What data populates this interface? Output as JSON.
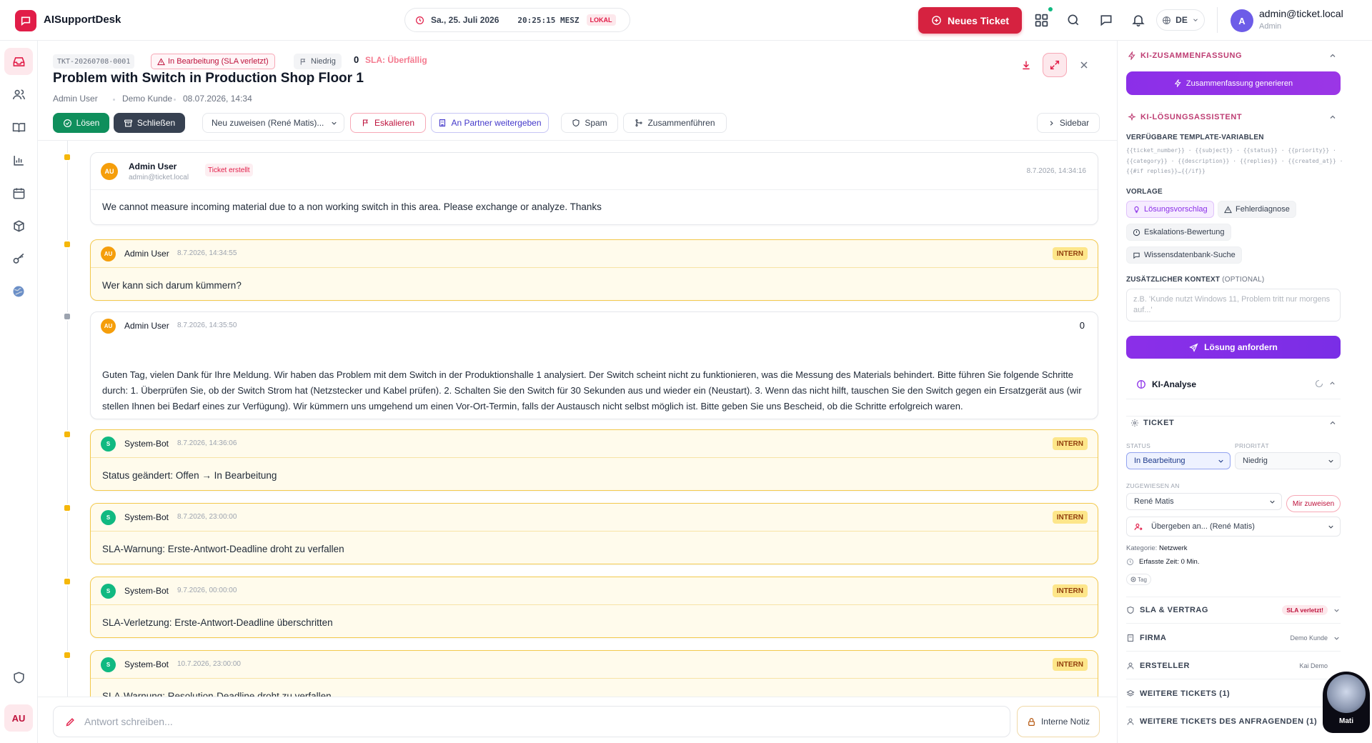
{
  "app": {
    "name": "AISupportDesk"
  },
  "datetime": {
    "date": "Sa., 25. Juli 2026",
    "time": "20:25:15 MESZ",
    "badge": "LOKAL"
  },
  "header": {
    "new_ticket": "Neues Ticket",
    "lang": "DE",
    "user_email": "admin@ticket.local",
    "user_role": "Admin",
    "avatar": "A"
  },
  "rail": {
    "avatar": "AU",
    "items": [
      "inbox-icon",
      "users-icon",
      "book-icon",
      "chart-icon",
      "calendar-icon",
      "box-icon",
      "key-icon",
      "globe-icon",
      "shield-icon"
    ]
  },
  "ticket": {
    "id": "TKT-20260708-0001",
    "status": "In Bearbeitung (SLA verletzt)",
    "priority": "Niedrig",
    "count": "0",
    "sla": "SLA: Überfällig",
    "title": "Problem with Switch in Production Shop Floor 1",
    "meta": [
      "Admin User",
      "Demo Kunde",
      "08.07.2026, 14:34"
    ],
    "actions": {
      "resolve": "Lösen",
      "close": "Schließen",
      "reassign": "Neu zuweisen (René Matis)...",
      "escalate": "Eskalieren",
      "partner": "An Partner weitergeben",
      "spam": "Spam",
      "merge": "Zusammenführen",
      "sidebar": "Sidebar"
    }
  },
  "timeline": [
    {
      "author": "Admin User",
      "email": "admin@ticket.local",
      "tag": "Ticket erstellt",
      "time": "8.7.2026, 14:34:16",
      "body": "We cannot measure incoming material due to a non working switch in this area. Please exchange or analyze. Thanks",
      "avatar": "AU"
    },
    {
      "author": "Admin User",
      "time": "8.7.2026, 14:34:55",
      "badge": "INTERN",
      "body": "Wer kann sich darum kümmern?",
      "avatar": "AU"
    },
    {
      "author": "Admin User",
      "time": "8.7.2026, 14:35:50",
      "count": "0",
      "body": "Guten Tag, vielen Dank für Ihre Meldung. Wir haben das Problem mit dem Switch in der Produktionshalle 1 analysiert. Der Switch scheint nicht zu funktionieren, was die Messung des Materials behindert. Bitte führen Sie folgende Schritte durch: 1. Überprüfen Sie, ob der Switch Strom hat (Netzstecker und Kabel prüfen). 2. Schalten Sie den Switch für 30 Sekunden aus und wieder ein (Neustart). 3. Wenn das nicht hilft, tauschen Sie den Switch gegen ein Ersatzgerät aus (wir stellen Ihnen bei Bedarf eines zur Verfügung). Wir kümmern uns umgehend um einen Vor-Ort-Termin, falls der Austausch nicht selbst möglich ist. Bitte geben Sie uns Bescheid, ob die Schritte erfolgreich waren.",
      "avatar": "AU"
    },
    {
      "author": "System-Bot",
      "time": "8.7.2026, 14:36:06",
      "badge": "INTERN",
      "body": "Status geändert: Offen → In Bearbeitung",
      "avatar": "S"
    },
    {
      "author": "System-Bot",
      "time": "8.7.2026, 23:00:00",
      "badge": "INTERN",
      "body": "SLA-Warnung: Erste-Antwort-Deadline droht zu verfallen",
      "avatar": "S"
    },
    {
      "author": "System-Bot",
      "time": "9.7.2026, 00:00:00",
      "badge": "INTERN",
      "body": "SLA-Verletzung: Erste-Antwort-Deadline überschritten",
      "avatar": "S"
    },
    {
      "author": "System-Bot",
      "time": "10.7.2026, 23:00:00",
      "badge": "INTERN",
      "body": "SLA-Warnung: Resolution-Deadline droht zu verfallen",
      "avatar": "S"
    }
  ],
  "reply": {
    "placeholder": "Antwort schreiben...",
    "note": "Interne Notiz"
  },
  "sidebar": {
    "summary_title": "KI-ZUSAMMENFASSUNG",
    "summary_btn": "Zusammenfassung generieren",
    "assistant_title": "KI-LÖSUNGSASSISTENT",
    "vars_label": "VERFÜGBARE TEMPLATE-VARIABLEN",
    "vars": "{{ticket_number}} · {{subject}} · {{status}} · {{priority}} · {{category}} · {{description}} · {{replies}} · {{created_at}} · {{#if replies}}…{{/if}}",
    "template_label": "VORLAGE",
    "templates": [
      "Lösungsvorschlag",
      "Fehlerdiagnose",
      "Eskalations-Bewertung",
      "Wissensdatenbank-Suche"
    ],
    "context_label": "ZUSÄTZLICHER KONTEXT",
    "context_optional": "(OPTIONAL)",
    "context_placeholder": "z.B. 'Kunde nutzt Windows 11, Problem tritt nur morgens auf...'",
    "request_btn": "Lösung anfordern",
    "ki_analysis": "KI-Analyse",
    "ticket_title": "TICKET",
    "status_label": "STATUS",
    "status_value": "In Bearbeitung",
    "priority_label": "PRIORITÄT",
    "priority_value": "Niedrig",
    "assigned_label": "ZUGEWIESEN AN",
    "assigned_value": "René Matis",
    "assign_me": "Mir zuweisen",
    "handover": "Übergeben an... (René Matis)",
    "category_label": "Kategorie:",
    "category_value": "Netzwerk",
    "time_label": "Erfasste Zeit: 0 Min.",
    "tag": "Tag",
    "sla_title": "SLA & VERTRAG",
    "sla_badge": "SLA verletzt!",
    "company_title": "FIRMA",
    "company_value": "Demo Kunde",
    "creator_title": "ERSTELLER",
    "creator_value": "Kai Demo",
    "more_tickets": "WEITERE TICKETS (1)",
    "more_requester": "WEITERE TICKETS DES ANFRAGENDEN (1)"
  },
  "mascot": {
    "name": "Mati"
  }
}
